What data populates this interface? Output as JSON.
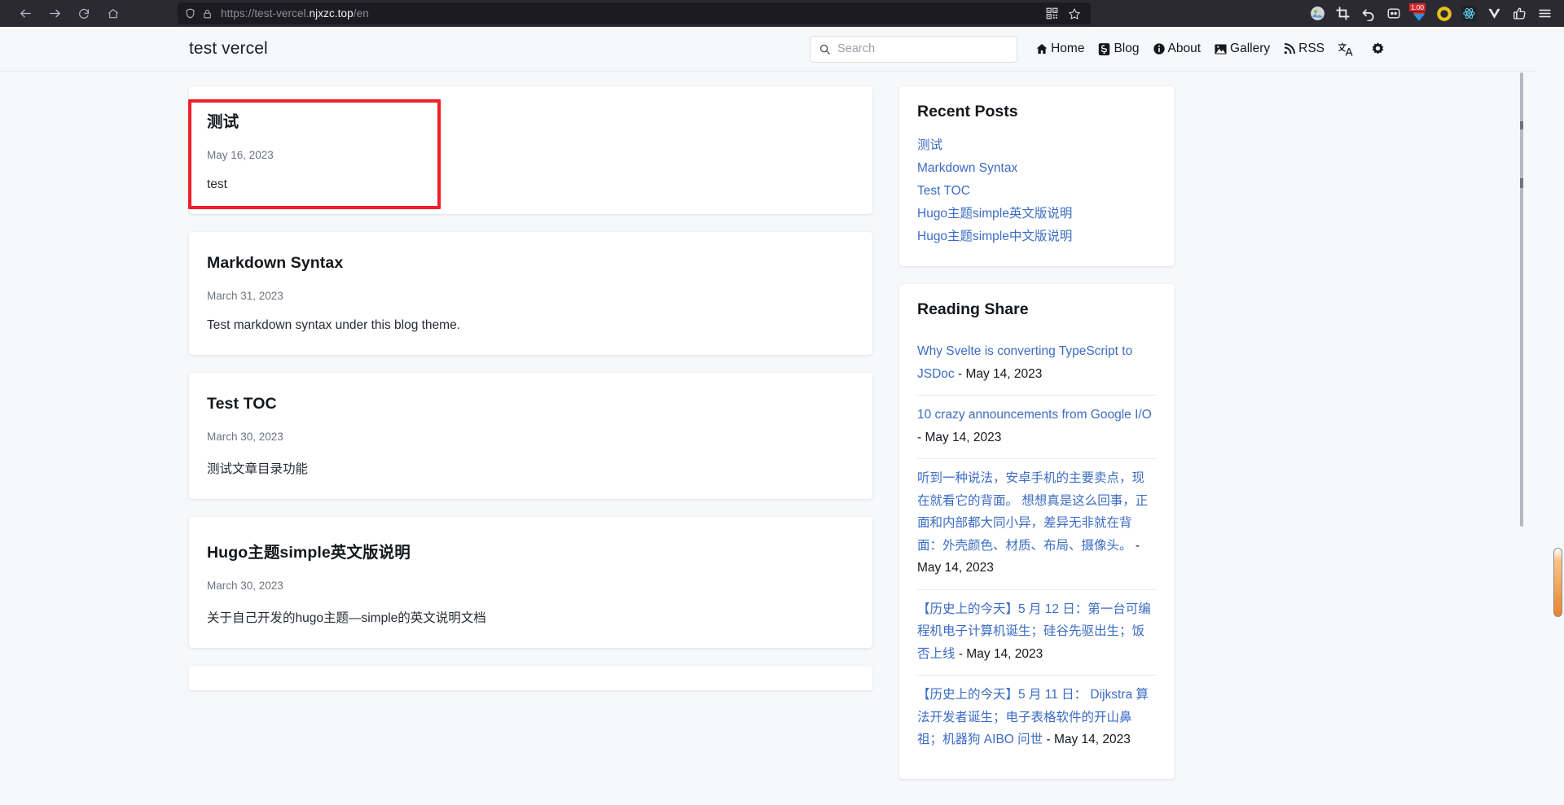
{
  "browser": {
    "url_prefix": "https://test-vercel.",
    "url_host": "njxzc.top",
    "url_suffix": "/en",
    "back_icon": "back-arrow-icon",
    "forward_icon": "forward-arrow-icon",
    "reload_icon": "reload-icon",
    "home_icon": "home-icon",
    "shield_icon": "shield-icon",
    "lock_icon": "lock-icon",
    "qr_icon": "qr-code-icon",
    "bookmark_icon": "star-icon",
    "extensions": [
      {
        "name": "profile-avatar",
        "badge": ""
      },
      {
        "name": "crop-extension-icon",
        "badge": ""
      },
      {
        "name": "undo-extension-icon",
        "badge": ""
      },
      {
        "name": "notebook-extension-icon",
        "badge": ""
      },
      {
        "name": "video-extension-icon",
        "badge": "1.00"
      },
      {
        "name": "ring-extension-icon",
        "badge": ""
      },
      {
        "name": "react-devtools-icon",
        "badge": ""
      },
      {
        "name": "vue-devtools-icon",
        "badge": ""
      },
      {
        "name": "thumbs-up-extension-icon",
        "badge": ""
      },
      {
        "name": "app-menu-icon",
        "badge": ""
      }
    ]
  },
  "site": {
    "title": "test vercel",
    "search": {
      "placeholder": "Search",
      "value": ""
    },
    "nav": [
      {
        "label": "Home",
        "icon": "home-icon"
      },
      {
        "label": "Blog",
        "icon": "blog-icon"
      },
      {
        "label": "About",
        "icon": "info-icon"
      },
      {
        "label": "Gallery",
        "icon": "image-icon"
      },
      {
        "label": "RSS",
        "icon": "rss-icon"
      },
      {
        "label": "",
        "icon": "translate-icon"
      },
      {
        "label": "",
        "icon": "gear-icon"
      }
    ]
  },
  "posts": [
    {
      "title": "测试",
      "date": "May 16, 2023",
      "summary": "test",
      "highlighted": true
    },
    {
      "title": "Markdown Syntax",
      "date": "March 31, 2023",
      "summary": "Test markdown syntax under this blog theme.",
      "highlighted": false
    },
    {
      "title": "Test TOC",
      "date": "March 30, 2023",
      "summary": "测试文章目录功能",
      "highlighted": false
    },
    {
      "title": "Hugo主题simple英文版说明",
      "date": "March 30, 2023",
      "summary": "关于自己开发的hugo主题—simple的英文说明文档",
      "highlighted": false
    }
  ],
  "sidebar": {
    "recent_posts": {
      "title": "Recent Posts",
      "items": [
        "测试",
        "Markdown Syntax",
        "Test TOC",
        "Hugo主题simple英文版说明",
        "Hugo主题simple中文版说明"
      ]
    },
    "reading_share": {
      "title": "Reading Share",
      "items": [
        {
          "link": "Why Svelte is converting TypeScript to JSDoc",
          "sep": " - ",
          "date": "May 14, 2023"
        },
        {
          "link": "10 crazy announcements from Google I/O",
          "sep": " - ",
          "date": "May 14, 2023"
        },
        {
          "link": "听到一种说法，安卓手机的主要卖点，现在就看它的背面。 想想真是这么回事，正面和内部都大同小异，差异无非就在背面：外壳颜色、材质、布局、摄像头。",
          "sep": " - ",
          "date": "May 14, 2023"
        },
        {
          "link": "【历史上的今天】5 月 12 日：第一台可编程机电子计算机诞生；硅谷先驱出生；饭否上线",
          "sep": " - ",
          "date": "May 14, 2023"
        },
        {
          "link": "【历史上的今天】5 月 11 日： Dijkstra 算法开发者诞生；电子表格软件的开山鼻祖；机器狗 AIBO 问世",
          "sep": " - ",
          "date": "May 14, 2023"
        }
      ]
    }
  },
  "colors": {
    "link": "#3c6cc4",
    "highlight_box": "#f01f28",
    "page_bg": "#f7f8fa",
    "chrome_bg": "#2b2a33"
  }
}
